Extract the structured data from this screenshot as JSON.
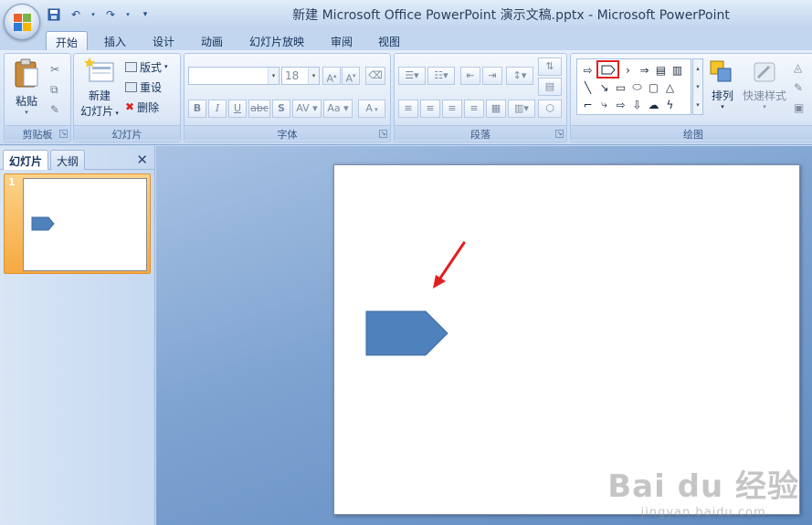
{
  "window": {
    "title": "新建 Microsoft Office PowerPoint 演示文稿.pptx - Microsoft PowerPoint"
  },
  "tabs": [
    "开始",
    "插入",
    "设计",
    "动画",
    "幻灯片放映",
    "审阅",
    "视图"
  ],
  "active_tab": "开始",
  "ribbon": {
    "clipboard": {
      "label": "剪贴板",
      "paste": "粘贴"
    },
    "slides": {
      "label": "幻灯片",
      "new_slide_line1": "新建",
      "new_slide_line2": "幻灯片",
      "layout": "版式",
      "reset": "重设",
      "delete": "删除"
    },
    "font": {
      "label": "字体",
      "font_name": "",
      "font_size": "18",
      "bold": "B",
      "italic": "I",
      "underline": "U",
      "strike": "abc",
      "shadow": "S",
      "spacing": "AV",
      "case": "Aa"
    },
    "paragraph": {
      "label": "段落"
    },
    "drawing": {
      "label": "绘图",
      "arrange": "排列",
      "quick_styles": "快速样式"
    }
  },
  "left_panel": {
    "tabs": [
      "幻灯片",
      "大纲"
    ],
    "active_tab": "幻灯片",
    "close": "✕",
    "slide_number": "1"
  },
  "watermark": {
    "main": "Bai du 经验",
    "sub": "jingyan.baidu.com"
  },
  "colors": {
    "shape_fill": "#4f81bd",
    "highlight": "#e02020",
    "arrow": "#e02020"
  }
}
